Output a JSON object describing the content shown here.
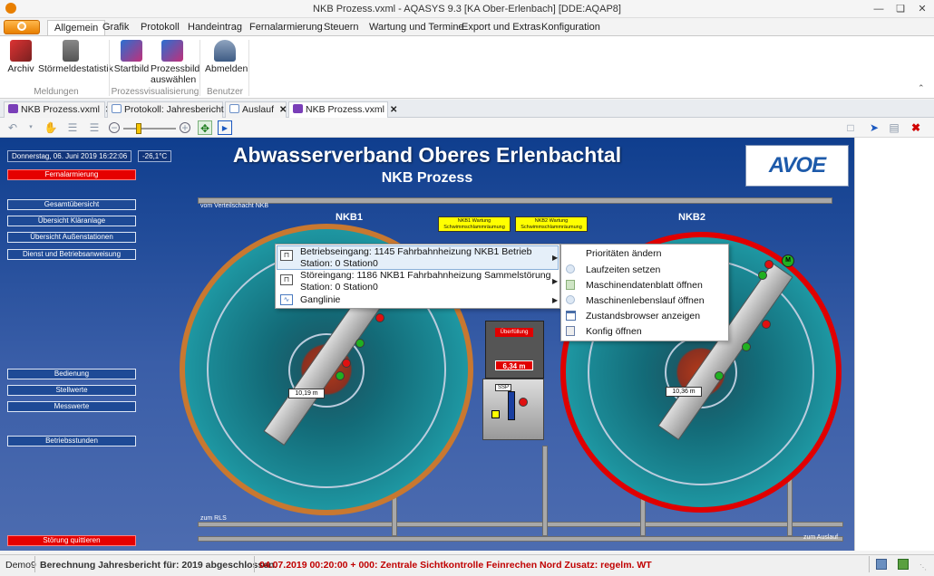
{
  "window": {
    "title": "NKB Prozess.vxml - AQASYS 9.3 [KA Ober-Erlenbach] [DDE:AQAP8]"
  },
  "ribbon": {
    "tabs": [
      "Allgemein",
      "Grafik",
      "Protokoll",
      "Handeintrag",
      "Fernalarmierung",
      "Steuern",
      "Wartung und Termine",
      "Export und Extras",
      "Konfiguration"
    ],
    "buttons": {
      "archiv": "Archiv",
      "stoermeld": "Störmeldestatistik",
      "startbild": "Startbild",
      "prozessbild1": "Prozessbild",
      "prozessbild2": "auswählen",
      "abmelden": "Abmelden"
    },
    "groups": {
      "meldungen": "Meldungen",
      "prozess": "Prozessvisualisierung",
      "benutzer": "Benutzer"
    }
  },
  "doc_tabs": [
    "NKB Prozess.vxml",
    "Protokoll: Jahresbericht",
    "Auslauf",
    "NKB Prozess.vxml"
  ],
  "scada": {
    "date": "Donnerstag, 06. Juni 2019 16:22:06",
    "temp": "-26,1°C",
    "fernalarm": "Fernalarmierung",
    "title": "Abwasserverband Oberes Erlenbachtal",
    "subtitle": "NKB Prozess",
    "logo": "AVOE",
    "nav": [
      "Gesamtübersicht",
      "Übersicht Kläranlage",
      "Übersicht Außenstationen",
      "Dienst und Betriebsanweisung"
    ],
    "nav2": [
      "Bedienung",
      "Stellwerte",
      "Messwerte"
    ],
    "betriebsstunden": "Betriebsstunden",
    "stoerung": "Störung quittieren",
    "pipe_in": "vom Verteilschacht NKB",
    "pipe_rls": "zum RLS",
    "pipe_out": "zum Auslauf",
    "nkb1": "NKB1",
    "nkb2": "NKB2",
    "warn1": "NKB1 Wartung Schwimmschlammräumung",
    "warn2": "NKB2 Wartung Schwimmschlammräumung",
    "val_nkb1": "10,19 m",
    "val_nkb2": "10,36 m",
    "ueberfuellung": "Überfüllung",
    "val_shaft": "6,34 m",
    "ssp": "SSP",
    "m": "M"
  },
  "menu1": {
    "item1_line1": "Betriebseingang: 1145 Fahrbahnheizung NKB1 Betrieb",
    "item1_line2": "Station: 0 Station0",
    "item2_line1": "Störeingang: 1186 NKB1 Fahrbahnheizung Sammelstörung",
    "item2_line2": "Station: 0 Station0",
    "item3": "Ganglinie"
  },
  "menu2": [
    "Prioritäten ändern",
    "Laufzeiten setzen",
    "Maschinendatenblatt öffnen",
    "Maschinenlebenslauf öffnen",
    "Zustandsbrowser anzeigen",
    "Konfig öffnen"
  ],
  "status": {
    "user": "Demo9",
    "msg1": "Berechnung Jahresbericht für: 2019 abgeschlossen.",
    "msg2": "04.07.2019 00:20:00 + 000: Zentrale Sichtkontrolle Feinrechen Nord Zusatz: regelm. WT"
  },
  "colors": {
    "accent": "#1d5aaa",
    "alarm": "#e50000",
    "status_red": "#c00000"
  }
}
